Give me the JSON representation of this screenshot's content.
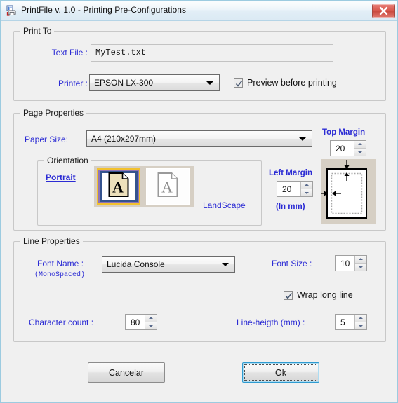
{
  "window": {
    "title": "PrintFile v. 1.0 - Printing Pre-Configurations",
    "app_icon": "printer-icon",
    "close_icon": "close-icon",
    "accent_color": "#2b2bd4",
    "close_color": "#c8473c",
    "selection_color": "#f2c12e"
  },
  "print_to": {
    "legend": "Print To",
    "text_file_label": "Text File :",
    "text_file_value": "MyTest.txt",
    "printer_label": "Printer :",
    "printer_value": "EPSON LX-300",
    "printer_options": [
      "EPSON LX-300"
    ],
    "preview_checkbox_label": "Preview before printing",
    "preview_checked": true
  },
  "page_properties": {
    "legend": "Page Properties",
    "paper_size_label": "Paper Size:",
    "paper_size_value": "A4 (210x297mm)",
    "paper_size_options": [
      "A4 (210x297mm)"
    ],
    "orientation": {
      "legend": "Orientation",
      "portrait_label": "Portrait",
      "landscape_label": "LandScape",
      "selected": "Portrait",
      "portrait_icon": "portrait-page-icon",
      "landscape_icon": "landscape-page-icon"
    },
    "top_margin_label": "Top Margin",
    "top_margin_value": "20",
    "left_margin_label": "Left Margin",
    "left_margin_value": "20",
    "units_label": "(In mm)",
    "preview_icon": "page-margin-preview"
  },
  "line_properties": {
    "legend": "Line Properties",
    "font_name_label": "Font Name :",
    "font_name_sub": "(MonoSpaced)",
    "font_name_value": "Lucida Console",
    "font_name_options": [
      "Lucida Console"
    ],
    "font_size_label": "Font Size :",
    "font_size_value": "10",
    "wrap_label": "Wrap long line",
    "wrap_checked": true,
    "char_count_label": "Character count :",
    "char_count_value": "80",
    "line_height_label": "Line-heigth (mm) :",
    "line_height_value": "5"
  },
  "footer": {
    "cancel_label": "Cancelar",
    "ok_label": "Ok"
  }
}
